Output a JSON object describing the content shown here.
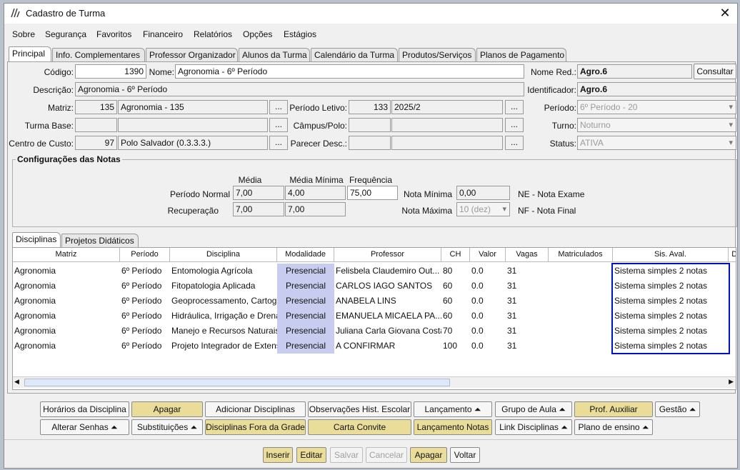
{
  "window": {
    "title": "Cadastro de Turma",
    "close": "✕"
  },
  "menu": [
    "Sobre",
    "Segurança",
    "Favoritos",
    "Financeiro",
    "Relatórios",
    "Opções",
    "Estágios"
  ],
  "tabs": [
    "Principal",
    "Info. Complementares",
    "Professor Organizador",
    "Alunos da Turma",
    "Calendário da Turma",
    "Produtos/Serviços",
    "Planos de Pagamento"
  ],
  "form": {
    "codigo_label": "Código:",
    "codigo": "1390",
    "nome_label": "Nome:",
    "nome": "Agronomia - 6º Período",
    "nome_red_label": "Nome Red.:",
    "nome_red": "Agro.6",
    "consultar": "Consultar",
    "descricao_label": "Descrição:",
    "descricao": "Agronomia - 6º Período",
    "identificador_label": "Identificador:",
    "identificador": "Agro.6",
    "matriz_label": "Matriz:",
    "matriz_cod": "135",
    "matriz_nome": "Agronomia - 135",
    "periodo_letivo_label": "Período Letivo:",
    "periodo_letivo_cod": "133",
    "periodo_letivo": "2025/2",
    "periodo_label": "Período:",
    "periodo": "6º Período - 20",
    "turma_base_label": "Turma Base:",
    "campus_label": "Câmpus/Polo:",
    "turno_label": "Turno:",
    "turno": "Noturno",
    "centro_custo_label": "Centro de Custo:",
    "centro_custo_cod": "97",
    "centro_custo": "Polo Salvador (0.3.3.3.)",
    "parecer_label": "Parecer Desc.:",
    "status_label": "Status:",
    "status": "ATIVA",
    "dots": "..."
  },
  "notas": {
    "title": "Configurações das Notas",
    "media_hdr": "Média",
    "media_min_hdr": "Média Mínima",
    "freq_hdr": "Frequência",
    "periodo_normal_label": "Período Normal",
    "pn_media": "7,00",
    "pn_media_min": "4,00",
    "pn_freq": "75,00",
    "recuperacao_label": "Recuperação",
    "rec_media": "7,00",
    "rec_media_min": "7,00",
    "nota_minima_label": "Nota Mínima",
    "nota_minima": "0,00",
    "nota_maxima_label": "Nota Máxima",
    "nota_maxima": "10 (dez)",
    "ne": "NE - Nota Exame",
    "nf": "NF - Nota Final"
  },
  "subtabs": [
    "Disciplinas",
    "Projetos Didáticos"
  ],
  "grid": {
    "columns": [
      "Matriz",
      "Período",
      "Disciplina",
      "Modalidade",
      "Professor",
      "CH",
      "Valor",
      "Vagas",
      "Matriculados",
      "Sis. Aval.",
      "Di"
    ],
    "rows": [
      [
        "Agronomia",
        "6º Período",
        "Entomologia Agrícola",
        "Presencial",
        "Felisbela Claudemiro Out...",
        "80",
        "0.0",
        "31",
        "",
        "Sistema simples 2 notas"
      ],
      [
        "Agronomia",
        "6º Período",
        "Fitopatologia Aplicada",
        "Presencial",
        "CARLOS IAGO SANTOS",
        "60",
        "0.0",
        "31",
        "",
        "Sistema simples 2 notas"
      ],
      [
        "Agronomia",
        "6º Período",
        "Geoprocessamento, Cartogr",
        "Presencial",
        "ANABELA LINS",
        "60",
        "0.0",
        "31",
        "",
        "Sistema simples 2 notas"
      ],
      [
        "Agronomia",
        "6º Período",
        "Hidráulica, Irrigação e Drena",
        "Presencial",
        "EMANUELA MICAELA PA...",
        "60",
        "0.0",
        "31",
        "",
        "Sistema simples 2 notas"
      ],
      [
        "Agronomia",
        "6º Período",
        "Manejo e Recursos Naturais",
        "Presencial",
        "Juliana Carla Giovana Costa",
        "70",
        "0.0",
        "31",
        "",
        "Sistema simples 2 notas"
      ],
      [
        "Agronomia",
        "6º Período",
        "Projeto Integrador de Extens",
        "Presencial",
        "A CONFIRMAR",
        "100",
        "0.0",
        "31",
        "",
        "Sistema simples 2 notas"
      ]
    ]
  },
  "buttons_row1": [
    "Horários da Disciplina",
    "Apagar",
    "Adicionar Disciplinas",
    "Observações Hist. Escolar",
    "Lançamento ⏶",
    "Grupo de Aula ⏶",
    "Prof. Auxiliar",
    "Gestão ⏶"
  ],
  "buttons_row2": [
    "Alterar Senhas ⏶",
    "Substituições ⏶",
    "Disciplinas Fora da Grade",
    "Carta Convite",
    "Lançamento Notas",
    "Link Disciplinas ⏶",
    "Plano de ensino ⏶"
  ],
  "bottom_buttons": [
    "Inserir",
    "Editar",
    "Salvar",
    "Cancelar",
    "Apagar",
    "Voltar"
  ]
}
